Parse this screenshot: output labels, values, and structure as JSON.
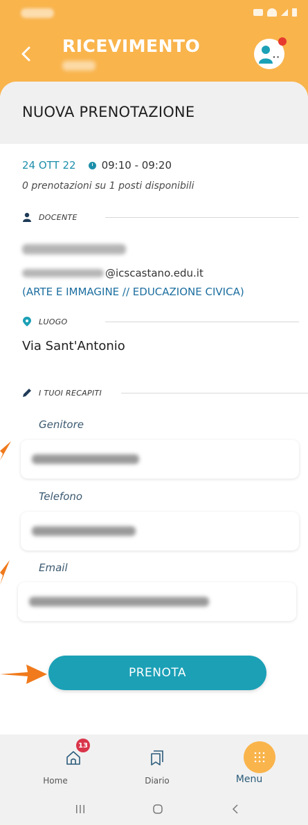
{
  "header": {
    "title": "RICEVIMENTO"
  },
  "form": {
    "title": "NUOVA PRENOTAZIONE",
    "date": "24 OTT 22",
    "time": "09:10 - 09:20",
    "availability": "0 prenotazioni su 1 posti disponibili"
  },
  "teacher": {
    "section_label": "DOCENTE",
    "email_domain": "@icscastano.edu.it",
    "subjects": "(ARTE E IMMAGINE // EDUCAZIONE CIVICA)"
  },
  "place": {
    "section_label": "LUOGO",
    "value": "Via Sant'Antonio"
  },
  "contacts": {
    "section_label": "I TUOI RECAPITI",
    "fields": [
      {
        "label": "Genitore"
      },
      {
        "label": "Telefono"
      },
      {
        "label": "Email"
      }
    ]
  },
  "submit_label": "PRENOTA",
  "bottom_nav": {
    "items": [
      {
        "label": "Home",
        "badge": "13",
        "icon": "home-icon"
      },
      {
        "label": "Diario",
        "icon": "diary-icon"
      },
      {
        "label": "Menu",
        "icon": "menu-grid-icon"
      }
    ]
  },
  "colors": {
    "header": "#f9b44c",
    "accent": "#1ba0b6",
    "annotation_arrow": "#f07a1c",
    "badge": "#d9354a"
  }
}
